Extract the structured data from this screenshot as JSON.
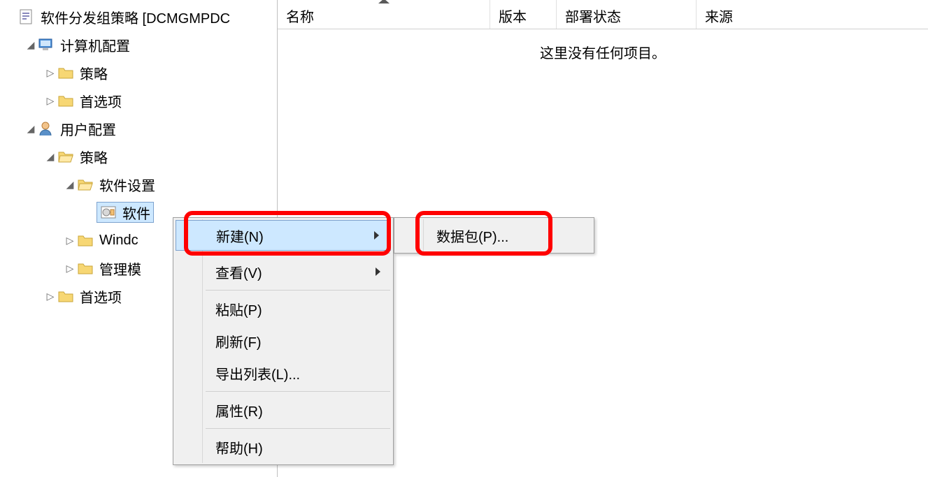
{
  "tree": {
    "root_label": "软件分发组策略 [DCMGMPDC",
    "computer_config": "计算机配置",
    "cc_policy": "策略",
    "cc_pref": "首选项",
    "user_config": "用户配置",
    "uc_policy": "策略",
    "sw_settings": "软件设置",
    "sw_install": "软件",
    "windows": "Windc",
    "admin_tmpl": "管理模",
    "uc_pref": "首选项"
  },
  "columns": {
    "name": "名称",
    "version": "版本",
    "deploy": "部署状态",
    "source": "来源"
  },
  "empty_text": "这里没有任何项目。",
  "ctx": {
    "new": "新建(N)",
    "view": "查看(V)",
    "paste": "粘贴(P)",
    "refresh": "刷新(F)",
    "export": "导出列表(L)...",
    "props": "属性(R)",
    "help": "帮助(H)"
  },
  "submenu": {
    "package": "数据包(P)..."
  }
}
